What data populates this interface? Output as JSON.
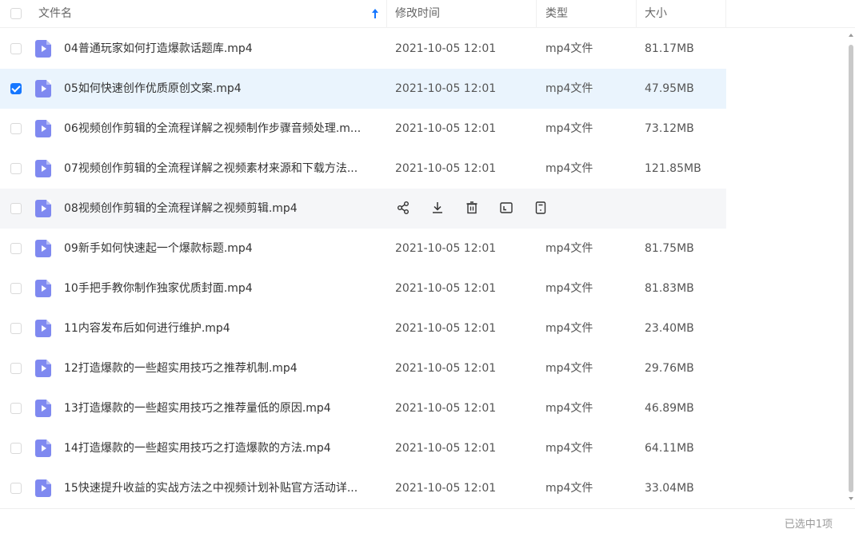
{
  "header": {
    "name_label": "文件名",
    "time_label": "修改时间",
    "type_label": "类型",
    "size_label": "大小",
    "sort": "ascending"
  },
  "rows": [
    {
      "name": "04普通玩家如何打造爆款话题库.mp4",
      "time": "2021-10-05 12:01",
      "type": "mp4文件",
      "size": "81.17MB",
      "checked": false,
      "state": "normal"
    },
    {
      "name": "05如何快速创作优质原创文案.mp4",
      "time": "2021-10-05 12:01",
      "type": "mp4文件",
      "size": "47.95MB",
      "checked": true,
      "state": "selected"
    },
    {
      "name": "06视频创作剪辑的全流程详解之视频制作步骤音频处理.m...",
      "time": "2021-10-05 12:01",
      "type": "mp4文件",
      "size": "73.12MB",
      "checked": false,
      "state": "normal"
    },
    {
      "name": "07视频创作剪辑的全流程详解之视频素材来源和下载方法...",
      "time": "2021-10-05 12:01",
      "type": "mp4文件",
      "size": "121.85MB",
      "checked": false,
      "state": "normal"
    },
    {
      "name": "08视频创作剪辑的全流程详解之视频剪辑.mp4",
      "time": "",
      "type": "",
      "size": "",
      "checked": false,
      "state": "hovered"
    },
    {
      "name": "09新手如何快速起一个爆款标题.mp4",
      "time": "2021-10-05 12:01",
      "type": "mp4文件",
      "size": "81.75MB",
      "checked": false,
      "state": "normal"
    },
    {
      "name": "10手把手教你制作独家优质封面.mp4",
      "time": "2021-10-05 12:01",
      "type": "mp4文件",
      "size": "81.83MB",
      "checked": false,
      "state": "normal"
    },
    {
      "name": "11内容发布后如何进行维护.mp4",
      "time": "2021-10-05 12:01",
      "type": "mp4文件",
      "size": "23.40MB",
      "checked": false,
      "state": "normal"
    },
    {
      "name": "12打造爆款的一些超实用技巧之推荐机制.mp4",
      "time": "2021-10-05 12:01",
      "type": "mp4文件",
      "size": "29.76MB",
      "checked": false,
      "state": "normal"
    },
    {
      "name": "13打造爆款的一些超实用技巧之推荐量低的原因.mp4",
      "time": "2021-10-05 12:01",
      "type": "mp4文件",
      "size": "46.89MB",
      "checked": false,
      "state": "normal"
    },
    {
      "name": "14打造爆款的一些超实用技巧之打造爆款的方法.mp4",
      "time": "2021-10-05 12:01",
      "type": "mp4文件",
      "size": "64.11MB",
      "checked": false,
      "state": "normal"
    },
    {
      "name": "15快速提升收益的实战方法之中视频计划补贴官方活动详...",
      "time": "2021-10-05 12:01",
      "type": "mp4文件",
      "size": "33.04MB",
      "checked": false,
      "state": "normal"
    }
  ],
  "hover_actions": [
    "share-icon",
    "download-icon",
    "delete-icon",
    "rename-icon",
    "more-icon"
  ],
  "footer": {
    "status": "已选中1项"
  },
  "colors": {
    "accent": "#1677ff",
    "selected_row": "#eaf4fd",
    "hover_row": "#f5f6f8",
    "file_icon": "#7f89f0"
  }
}
